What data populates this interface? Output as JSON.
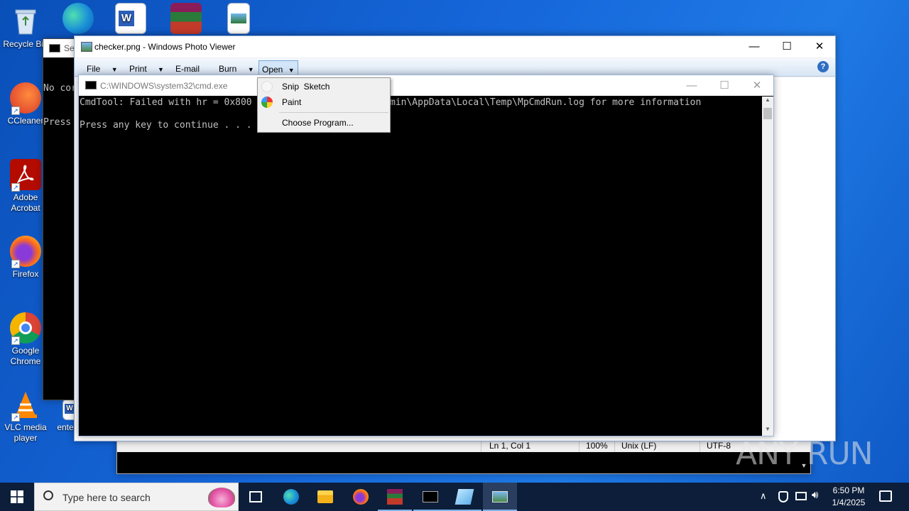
{
  "desktop": {
    "icons": [
      {
        "label": "Recycle Bin"
      },
      {
        "label": "CCleaner"
      },
      {
        "label": "Adobe Acrobat"
      },
      {
        "label": "Firefox"
      },
      {
        "label": "Google Chrome"
      },
      {
        "label": "VLC media player"
      }
    ],
    "partial_labels": [
      "ente"
    ],
    "watermark": "ANY RUN"
  },
  "select_window": {
    "title_fragment": "Sel",
    "console_lines": [
      "No cor",
      "Press"
    ]
  },
  "photo_viewer": {
    "title": "checker.png - Windows Photo Viewer",
    "menu": {
      "file": "File",
      "print": "Print",
      "email": "E-mail",
      "burn": "Burn",
      "open": "Open"
    },
    "help_icon": "help-icon"
  },
  "open_menu": {
    "items": [
      "Snip  Sketch",
      "Paint",
      "Choose Program..."
    ]
  },
  "cmd_window": {
    "title": "C:\\WINDOWS\\system32\\cmd.exe",
    "line1": "CmdTool: Failed with hr = 0x800",
    "line1_tail": "min\\AppData\\Local\\Temp\\MpCmdRun.log for more information",
    "line2": "Press any key to continue . . ."
  },
  "notepad_status": {
    "position": "Ln 1, Col 1",
    "zoom": "100%",
    "line_ending": "Unix (LF)",
    "encoding": "UTF-8"
  },
  "taskbar": {
    "search_placeholder": "Type here to search",
    "time": "6:50 PM",
    "date": "1/4/2025"
  }
}
